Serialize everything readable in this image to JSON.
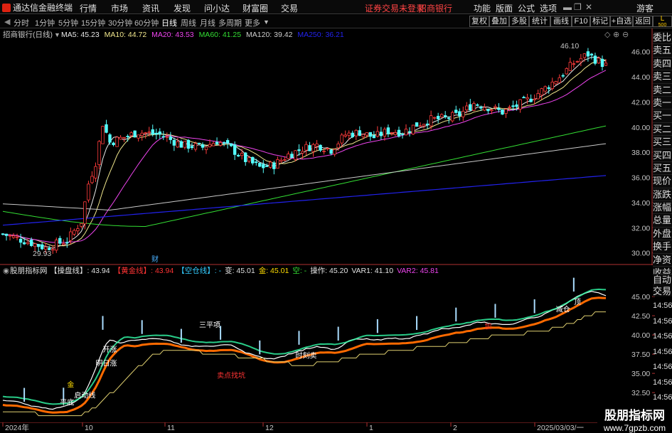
{
  "app": {
    "name": "通达信金融终端",
    "warn": "证券交易未登录",
    "stock": "招商银行",
    "user": "游客"
  },
  "menu": [
    "行情",
    "市场",
    "资讯",
    "发现",
    "问小达",
    "财富圈",
    "交易"
  ],
  "menu_right": [
    "功能",
    "版面",
    "公式",
    "选项"
  ],
  "periods": [
    "分时",
    "1分钟",
    "5分钟",
    "15分钟",
    "30分钟",
    "60分钟",
    "日线",
    "周线",
    "月线",
    "多周期",
    "更多"
  ],
  "active_period": "日线",
  "toolbar_right": [
    "复权",
    "叠加",
    "多股",
    "统计",
    "画线",
    "F10",
    "标记",
    "+自选",
    "返回"
  ],
  "corner_label": "L",
  "corner_sub": "500",
  "main": {
    "title": "招商银行(日线)",
    "ma": [
      {
        "label": "MA5: 45.23",
        "color": "#e8e8e8"
      },
      {
        "label": "MA10: 44.72",
        "color": "#f0e68c"
      },
      {
        "label": "MA20: 43.53",
        "color": "#ee44ee"
      },
      {
        "label": "MA60: 41.25",
        "color": "#33dd33"
      },
      {
        "label": "MA120: 39.42",
        "color": "#cccccc"
      },
      {
        "label": "MA250: 36.21",
        "color": "#2222ee"
      }
    ],
    "y_ticks": [
      "46.00",
      "44.00",
      "42.00",
      "40.00",
      "38.00",
      "36.00",
      "34.00",
      "32.00",
      "30.00"
    ],
    "high": "46.10",
    "low": "29.93",
    "fin": "财"
  },
  "sub": {
    "title": "股朋指标网",
    "items": [
      {
        "t": "【操盘线】: 43.94",
        "c": "#e0e0e0"
      },
      {
        "t": "【黄金线】: 43.94",
        "c": "#ff3333"
      },
      {
        "t": "【空仓线】: -",
        "c": "#33ccff"
      },
      {
        "t": "变: 45.01",
        "c": "#e0e0e0"
      },
      {
        "t": "金: 45.01",
        "c": "#ffdd00"
      },
      {
        "t": "空: -",
        "c": "#33dd33"
      },
      {
        "t": "操作: 45.20",
        "c": "#e0e0e0"
      },
      {
        "t": "VAR1: 41.10",
        "c": "#e0e0e0"
      },
      {
        "t": "VAR2: 45.81",
        "c": "#ee44ee"
      }
    ],
    "y_ticks": [
      "45.00",
      "42.50",
      "40.00",
      "37.50",
      "35.00",
      "32.50",
      "30.00"
    ],
    "labels": [
      {
        "t": "平底",
        "c": "#ffffff"
      },
      {
        "t": "启动线",
        "c": "#ffffff"
      },
      {
        "t": "金",
        "c": "#ffdd00"
      },
      {
        "t": "明日涨",
        "c": "#ffffff"
      },
      {
        "t": "开涨",
        "c": "#ffffff"
      },
      {
        "t": "三平项",
        "c": "#ffffff"
      },
      {
        "t": "卖点找坑",
        "c": "#ff3333"
      },
      {
        "t": "时刻卖",
        "c": "#ffffff"
      },
      {
        "t": "加",
        "c": "#ff3333"
      },
      {
        "t": "顶",
        "c": "#ffffff"
      },
      {
        "t": "减仓",
        "c": "#ffffff"
      }
    ]
  },
  "right_panel": [
    "委比",
    "卖五",
    "卖四",
    "卖三",
    "卖二",
    "卖一",
    "买一",
    "买二",
    "买三",
    "买四",
    "买五",
    "现价",
    "涨跌",
    "涨幅",
    "总量",
    "外盘",
    "换手",
    "净资",
    "收益"
  ],
  "right_sub": [
    "自动",
    "交易"
  ],
  "right_times": [
    "14:56",
    "14:56",
    "14:56",
    "14:56",
    "14:56",
    "14:56",
    "14:56",
    "14:56"
  ],
  "x_axis": [
    "2024年",
    "10",
    "11",
    "12",
    "1",
    "2",
    "2025/03/03/一"
  ],
  "watermark": {
    "line1": "股朋指标网",
    "line2": "www.7gpzb.com"
  },
  "chart_data": [
    {
      "type": "candlestick",
      "title": "招商银行(日线)",
      "ylim": [
        29,
        47
      ],
      "series": [
        {
          "name": "MA5",
          "value": 45.23
        },
        {
          "name": "MA10",
          "value": 44.72
        },
        {
          "name": "MA20",
          "value": 43.53
        },
        {
          "name": "MA60",
          "value": 41.25
        },
        {
          "name": "MA120",
          "value": 39.42
        },
        {
          "name": "MA250",
          "value": 36.21
        }
      ],
      "high": 46.1,
      "low": 29.93
    },
    {
      "type": "line",
      "title": "股朋指标网",
      "ylim": [
        29,
        48
      ],
      "series": [
        {
          "name": "操盘线",
          "value": 43.94
        },
        {
          "name": "黄金线",
          "value": 43.94
        },
        {
          "name": "变",
          "value": 45.01
        },
        {
          "name": "金",
          "value": 45.01
        },
        {
          "name": "操作",
          "value": 45.2
        },
        {
          "name": "VAR1",
          "value": 41.1
        },
        {
          "name": "VAR2",
          "value": 45.81
        }
      ]
    }
  ]
}
